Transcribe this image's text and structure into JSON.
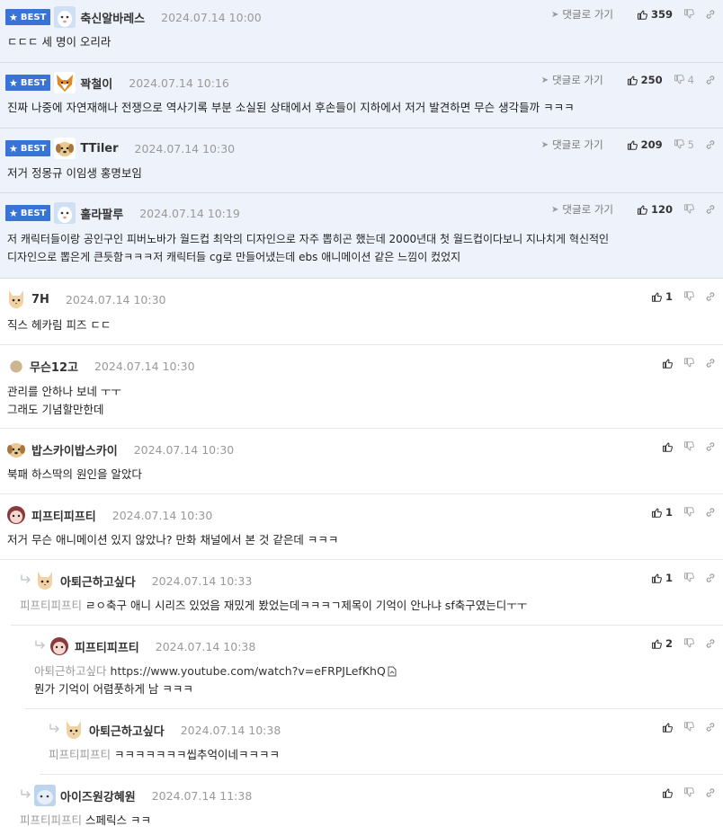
{
  "labels": {
    "best": "BEST",
    "reply": "댓글로 가기"
  },
  "best_comments": [
    {
      "nick": "축신알바레스",
      "date": "2024.07.14 10:00",
      "likes": "359",
      "dislikes": "",
      "text": "ㄷㄷㄷ 세 명이 오리라"
    },
    {
      "nick": "꽉철이",
      "date": "2024.07.14 10:16",
      "likes": "250",
      "dislikes": "4",
      "text": "진짜 나중에 자연재해나 전쟁으로 역사기록 부분 소실된 상태에서 후손들이 지하에서 저거 발견하면 무슨 생각들까 ㅋㅋㅋ"
    },
    {
      "nick": "TTiler",
      "date": "2024.07.14 10:30",
      "likes": "209",
      "dislikes": "5",
      "text": "저거 정몽규 이임생 홍명보임"
    },
    {
      "nick": "훌라팔루",
      "date": "2024.07.14 10:19",
      "likes": "120",
      "dislikes": "",
      "text_line1": "저 캐릭터들이랑 공인구인 피버노바가 월드컵 최악의 디자인으로 자주 뽑히곤 했는데 2000년대 첫 월드컵이다보니 지나치게 혁신적인",
      "text_line2": "디자인으로 뽑은게 큰듯함ㅋㅋㅋ저 캐릭터들 cg로 만들어냈는데 ebs 애니메이션 같은 느낌이 컸었지"
    }
  ],
  "comments": [
    {
      "nick": "7H",
      "date": "2024.07.14 10:30",
      "likes": "1",
      "text": "직스 헤카림 피즈 ㄷㄷ"
    },
    {
      "nick": "무슨12고",
      "date": "2024.07.14 10:30",
      "likes": "",
      "text_line1": "관리를 안하나 보네 ㅜㅜ",
      "text_line2": "그래도 기념할만한데"
    },
    {
      "nick": "밥스카이밥스카이",
      "date": "2024.07.14 10:30",
      "likes": "",
      "text": "북패 하스딱의 원인을 알았다"
    },
    {
      "nick": "피프티피프티",
      "date": "2024.07.14 10:30",
      "likes": "1",
      "text": "저거 무슨 애니메이션 있지 않았나? 만화 채널에서 본 것 같은데 ㅋㅋㅋ"
    },
    {
      "nick": "아퇴근하고싶다",
      "date": "2024.07.14 10:33",
      "likes": "1",
      "reply_to": "피프티피프티",
      "text": "ㄹㅇ축구 애니 시리즈 있었음 재밌게 봤었는데ㅋㅋㅋㄱ제목이 기억이 안나냐 sf축구였는디ㅜㅜ"
    },
    {
      "nick": "피프티피프티",
      "date": "2024.07.14 10:38",
      "likes": "2",
      "reply_to": "아퇴근하고싶다",
      "link": "https://www.youtube.com/watch?v=eFRPJLefKhQ",
      "text": "뭔가 기억이 어렴풋하게 남 ㅋㅋㅋ"
    },
    {
      "nick": "아퇴근하고싶다",
      "date": "2024.07.14 10:38",
      "likes": "",
      "reply_to": "피프티피프티",
      "text": "ㅋㅋㅋㅋㅋㅋㅋ씹추억이네ㅋㅋㅋㅋ"
    },
    {
      "nick": "아이즈원강혜원",
      "date": "2024.07.14 11:38",
      "likes": "",
      "reply_to": "피프티피프티",
      "text": "스페릭스 ㅋㅋ"
    }
  ],
  "colors": {
    "best_bg": "#eef3fb",
    "badge": "#3a73d6",
    "muted": "#999999"
  },
  "icons": [
    "star-icon",
    "paper-plane-icon",
    "thumbs-up-icon",
    "thumbs-down-icon",
    "link-icon",
    "reply-arrow-icon",
    "file-icon"
  ]
}
